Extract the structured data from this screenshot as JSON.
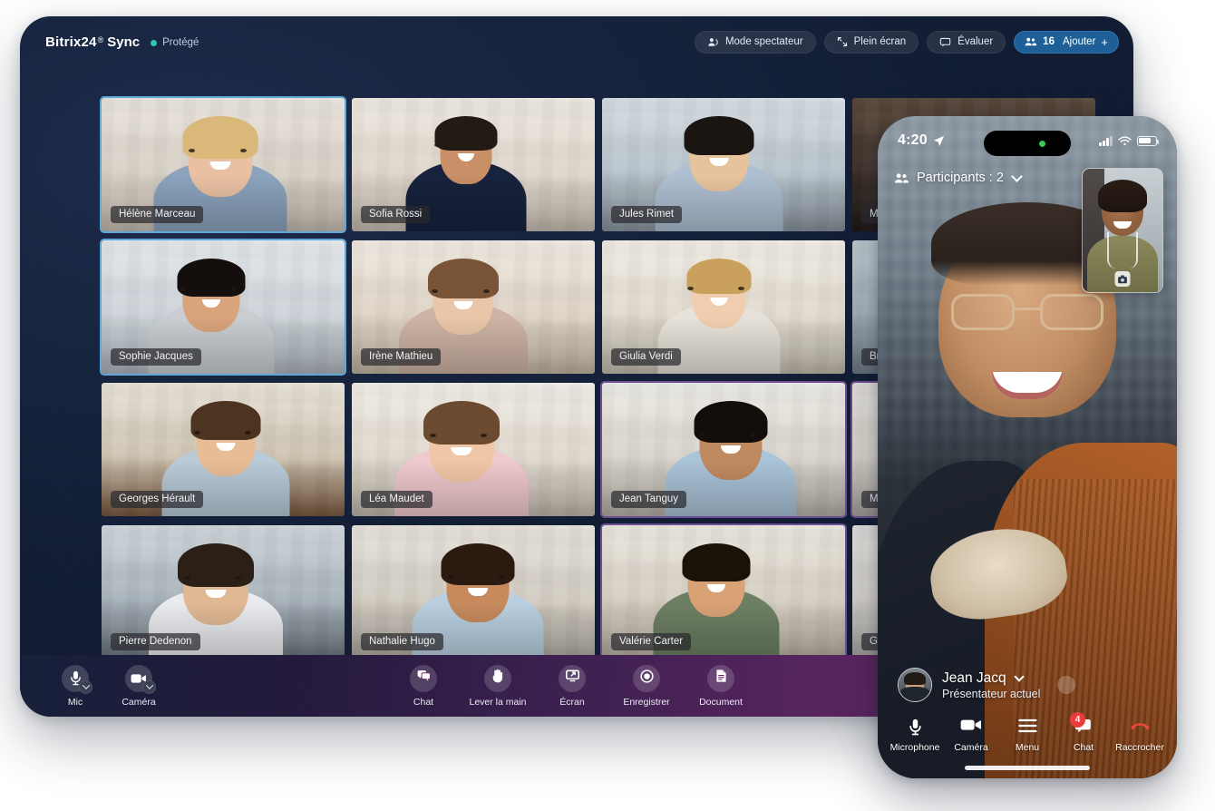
{
  "app": {
    "brand_primary": "Bitrix24",
    "brand_reg": "®",
    "brand_secondary": "Sync",
    "protected_label": "Protégé",
    "protected_dot_color": "#31c7ad"
  },
  "toolbar": {
    "spectator_label": "Mode spectateur",
    "fullscreen_label": "Plein écran",
    "rate_label": "Évaluer",
    "participants_count": "16",
    "add_label": "Ajouter",
    "add_plus": "+",
    "accent_color": "#1d5f96"
  },
  "grid": {
    "tiles": [
      {
        "name": "Hélène Marceau",
        "border": "blue"
      },
      {
        "name": "Sofia Rossi",
        "border": "none"
      },
      {
        "name": "Jules Rimet",
        "border": "none"
      },
      {
        "name": "Max Stok",
        "border": "none"
      },
      {
        "name": "Sophie Jacques",
        "border": "blue"
      },
      {
        "name": "Irène Mathieu",
        "border": "none"
      },
      {
        "name": "Giulia Verdi",
        "border": "none"
      },
      {
        "name": "Bruno Le",
        "border": "none"
      },
      {
        "name": "Georges Hérault",
        "border": "none"
      },
      {
        "name": "Léa Maudet",
        "border": "none"
      },
      {
        "name": "Jean Tanguy",
        "border": "violet"
      },
      {
        "name": "Marion A",
        "border": "violet"
      },
      {
        "name": "Pierre Dedenon",
        "border": "none"
      },
      {
        "name": "Nathalie Hugo",
        "border": "none"
      },
      {
        "name": "Valérie Carter",
        "border": "violet"
      },
      {
        "name": "Geoffrey",
        "border": "none"
      }
    ]
  },
  "controls": {
    "left": [
      {
        "label": "Mic",
        "icon": "microphone-icon",
        "has_caret": true
      },
      {
        "label": "Caméra",
        "icon": "camera-icon",
        "has_caret": true
      }
    ],
    "center": [
      {
        "label": "Chat",
        "icon": "chat-icon"
      },
      {
        "label": "Lever la main",
        "icon": "raise-hand-icon"
      },
      {
        "label": "Écran",
        "icon": "screen-share-icon"
      },
      {
        "label": "Enregistrer",
        "icon": "record-icon"
      },
      {
        "label": "Document",
        "icon": "document-icon"
      }
    ]
  },
  "phone": {
    "status": {
      "time": "4:20",
      "location_icon": "location-arrow-icon",
      "signal_icon": "cellular-signal-icon",
      "wifi_icon": "wifi-icon",
      "battery_icon": "battery-icon",
      "island_dot_color": "#34c759"
    },
    "participants_label": "Participants : 2",
    "selfview_flip_icon": "camera-flip-icon",
    "presenter": {
      "name": "Jean Jacq",
      "subtitle": "Présentateur actuel",
      "chevron_icon": "chevron-down-icon"
    },
    "tabs": [
      {
        "label": "Microphone",
        "icon": "microphone-icon",
        "badge": null
      },
      {
        "label": "Caméra",
        "icon": "camera-icon",
        "badge": null
      },
      {
        "label": "Menu",
        "icon": "hamburger-menu-icon",
        "badge": null
      },
      {
        "label": "Chat",
        "icon": "chat-bubble-icon",
        "badge": "4"
      },
      {
        "label": "Raccrocher",
        "icon": "hang-up-icon",
        "badge": null
      }
    ],
    "badge_color": "#eb3b3b"
  }
}
